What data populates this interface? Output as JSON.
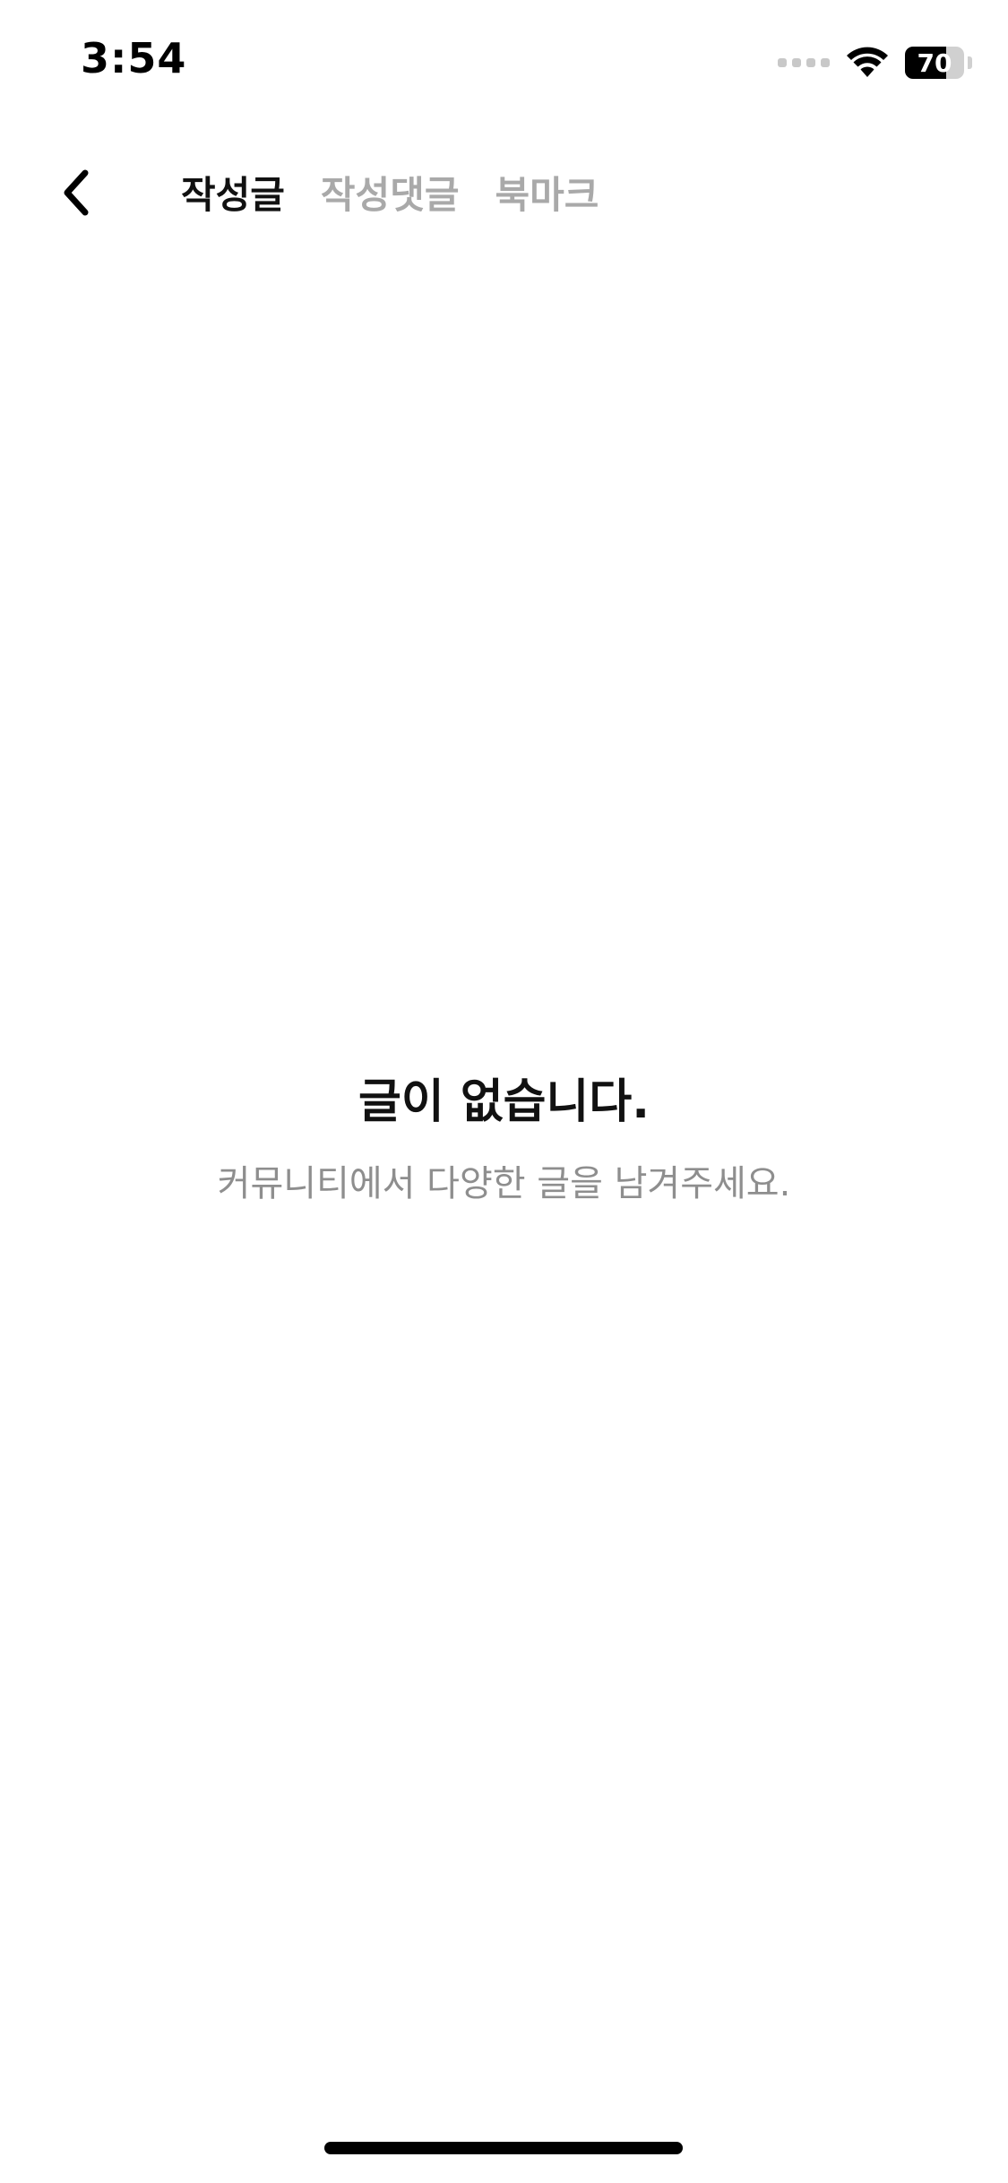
{
  "status_bar": {
    "time": "3:54",
    "battery_level": "70",
    "battery_fraction": 0.7,
    "signal_icon": "cellular-signal-icon",
    "wifi_icon": "wifi-icon",
    "battery_icon": "battery-icon"
  },
  "header": {
    "back_icon": "chevron-left-icon",
    "tabs": [
      {
        "label": "작성글",
        "active": true
      },
      {
        "label": "작성댓글",
        "active": false
      },
      {
        "label": "북마크",
        "active": false
      }
    ]
  },
  "empty_state": {
    "title": "글이 없습니다.",
    "subtitle": "커뮤니티에서 다양한 글을 남겨주세요."
  },
  "colors": {
    "active_tab": "#111111",
    "inactive_tab": "#a9a9a9",
    "subtitle": "#8e8e8e",
    "background": "#ffffff"
  }
}
